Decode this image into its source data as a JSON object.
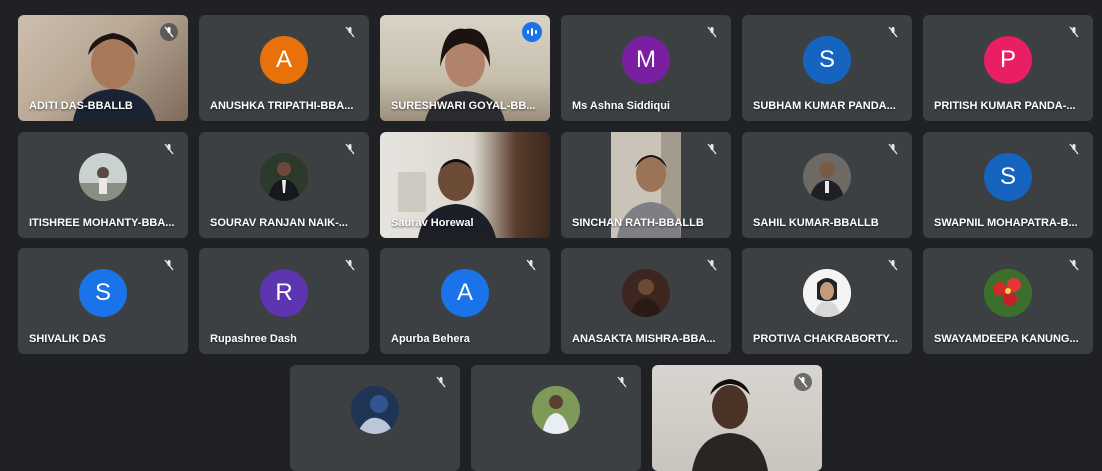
{
  "participants": [
    {
      "name": "ADITI DAS-BBALLB",
      "type": "video",
      "muted": true
    },
    {
      "name": "ANUSHKA TRIPATHI-BBA...",
      "type": "initial",
      "initial": "A",
      "color": "#e8710a",
      "muted": true
    },
    {
      "name": "SURESHWARI GOYAL-BB...",
      "type": "video",
      "muted": false,
      "speaking": true
    },
    {
      "name": "Ms Ashna Siddiqui",
      "type": "initial",
      "initial": "M",
      "color": "#7b1fa2",
      "muted": true
    },
    {
      "name": "SUBHAM KUMAR PANDA...",
      "type": "initial",
      "initial": "S",
      "color": "#1565c0",
      "muted": true
    },
    {
      "name": "PRITISH KUMAR PANDA-...",
      "type": "initial",
      "initial": "P",
      "color": "#e91e63",
      "muted": true
    },
    {
      "name": "ITISHREE MOHANTY-BBA...",
      "type": "photo",
      "muted": true
    },
    {
      "name": "SOURAV RANJAN NAIK-...",
      "type": "photo",
      "muted": true
    },
    {
      "name": "Saurav Horewal",
      "type": "video",
      "muted": false
    },
    {
      "name": "SINCHAN RATH-BBALLB",
      "type": "video",
      "muted": true
    },
    {
      "name": "SAHIL KUMAR-BBALLB",
      "type": "photo",
      "muted": true
    },
    {
      "name": "SWAPNIL MOHAPATRA-B...",
      "type": "initial",
      "initial": "S",
      "color": "#1565c0",
      "muted": true
    },
    {
      "name": "SHIVALIK DAS",
      "type": "initial",
      "initial": "S",
      "color": "#1a73e8",
      "muted": true
    },
    {
      "name": "Rupashree Dash",
      "type": "initial",
      "initial": "R",
      "color": "#5e35b1",
      "muted": true
    },
    {
      "name": "Apurba Behera",
      "type": "initial",
      "initial": "A",
      "color": "#1a73e8",
      "muted": true
    },
    {
      "name": "ANASAKTA MISHRA-BBA...",
      "type": "photo",
      "muted": true
    },
    {
      "name": "PROTIVA CHAKRABORTY...",
      "type": "photo",
      "muted": true
    },
    {
      "name": "SWAYAMDEEPA KANUNG...",
      "type": "photo",
      "muted": true
    },
    {
      "name": "",
      "type": "photo",
      "muted": true
    },
    {
      "name": "",
      "type": "photo",
      "muted": true
    },
    {
      "name": "",
      "type": "video",
      "muted": true
    }
  ]
}
